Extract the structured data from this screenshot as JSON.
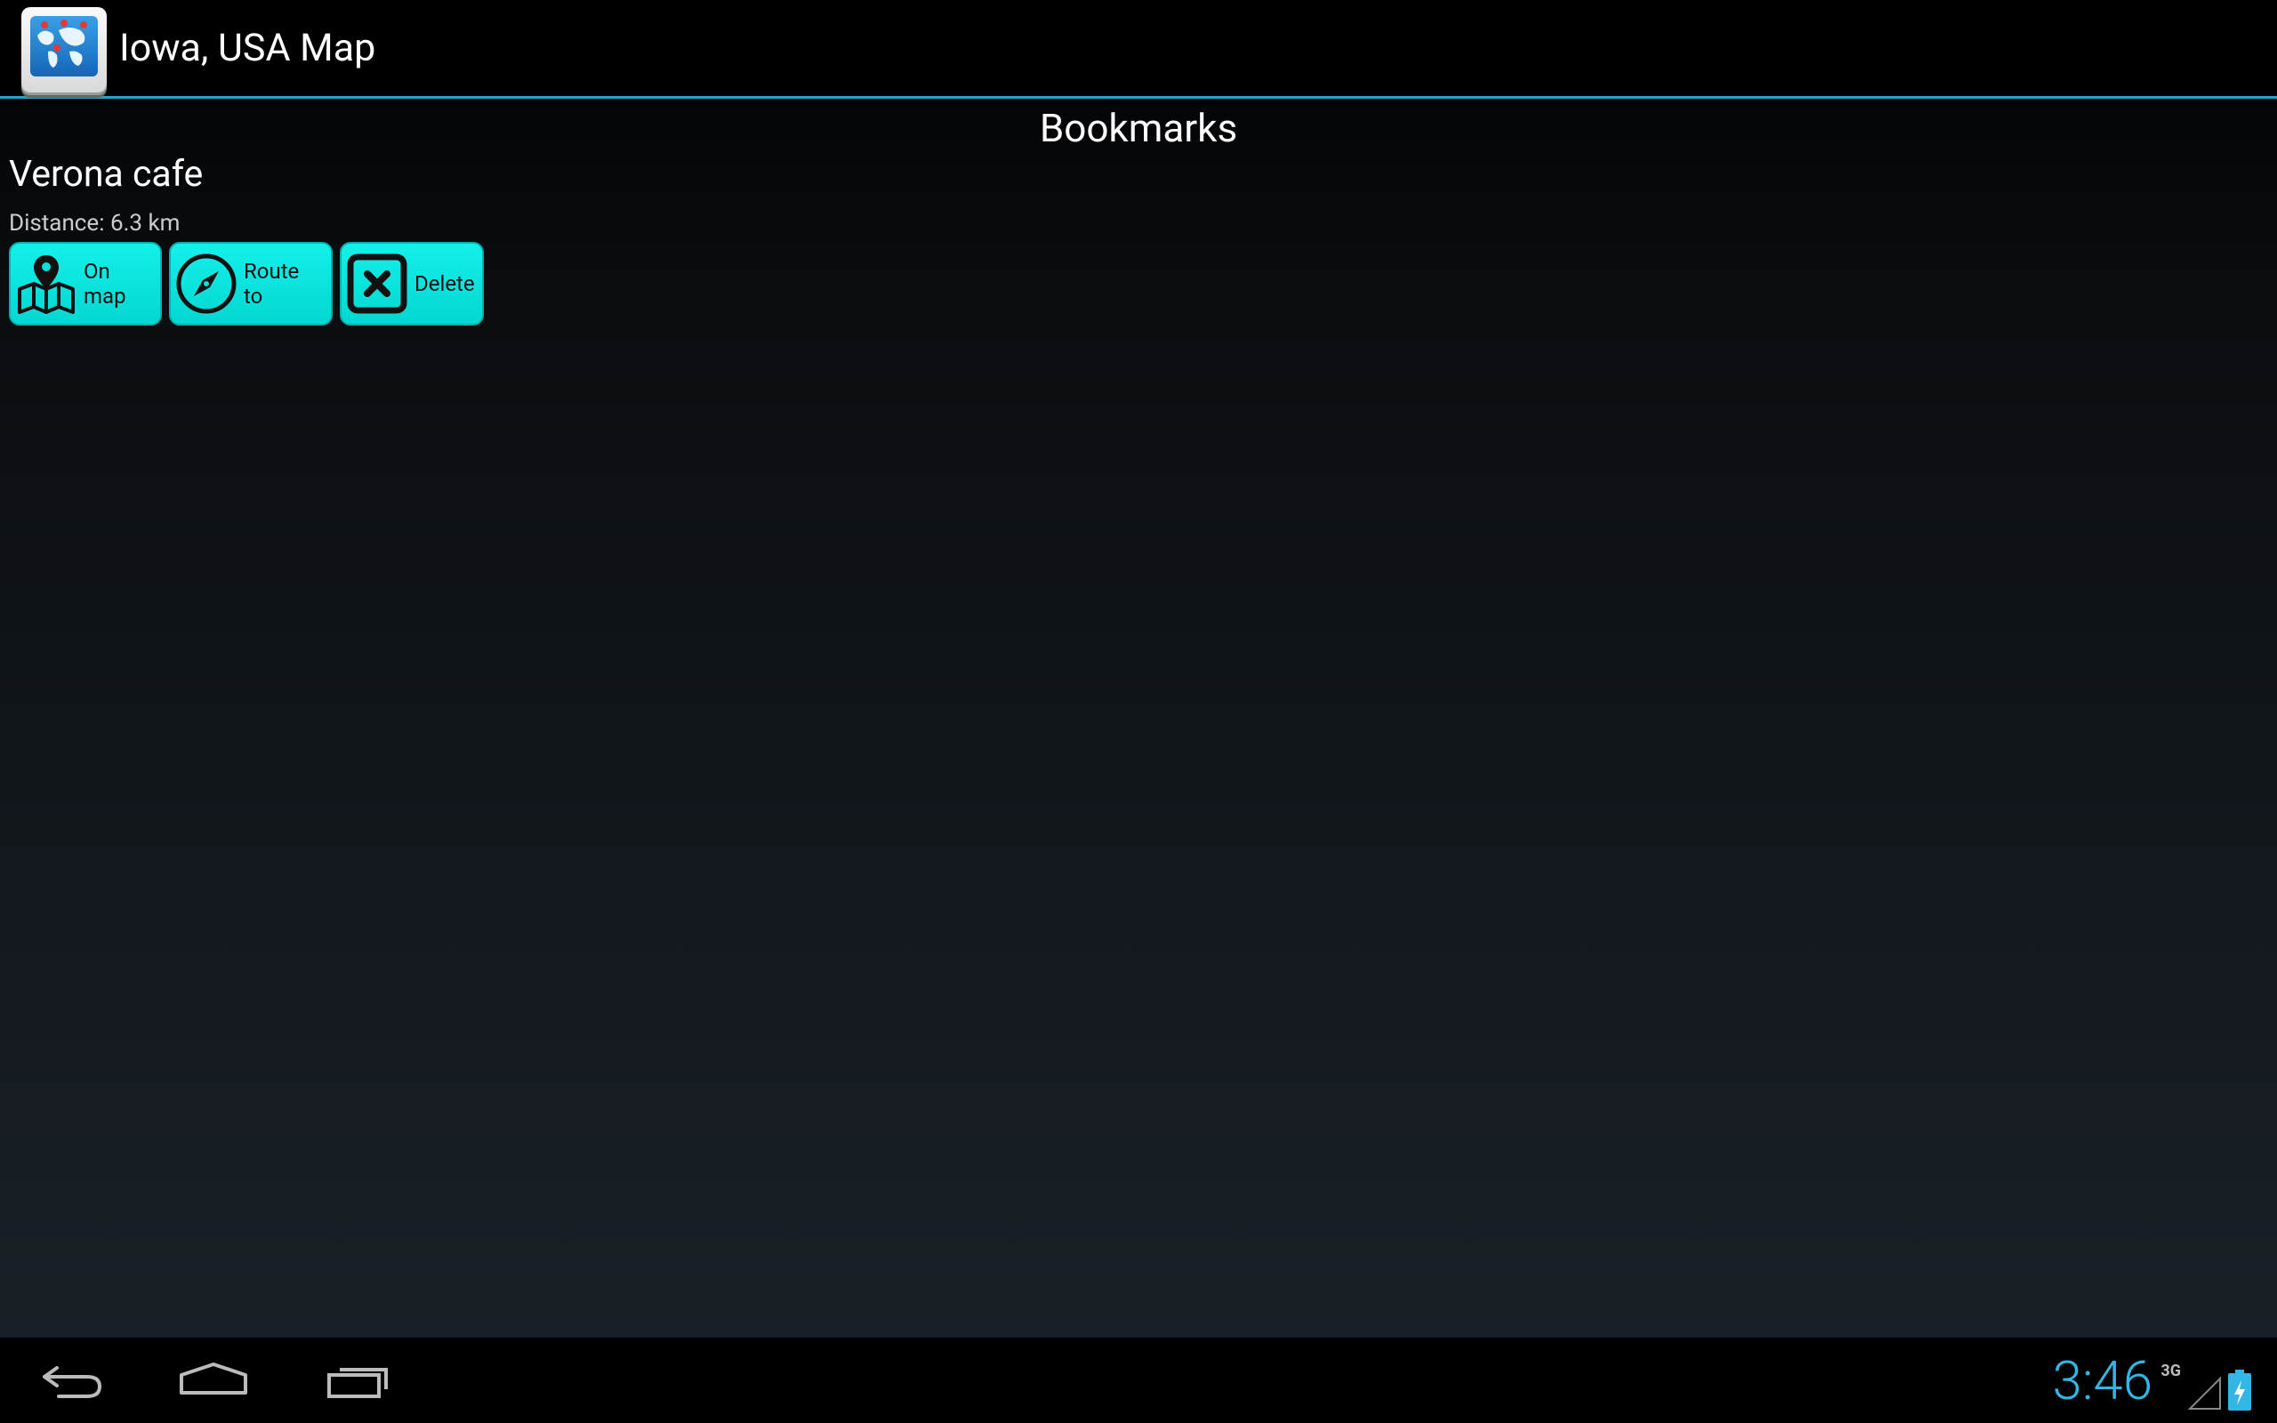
{
  "app": {
    "title": "Iowa, USA Map"
  },
  "content": {
    "section_title": "Bookmarks",
    "bookmark": {
      "name": "Verona  cafe",
      "distance": "Distance: 6.3 km"
    },
    "buttons": {
      "on_map": "On map",
      "route_to": "Route to",
      "delete": "Delete"
    }
  },
  "status_bar": {
    "clock": "3:46",
    "network": "3G"
  },
  "colors": {
    "accent": "#33b5e5",
    "button": "#08e0db",
    "divider": "#2a9fc9"
  },
  "icons": {
    "app": "world-map-icon",
    "on_map": "map-pin-icon",
    "route_to": "compass-icon",
    "delete": "close-box-icon",
    "back": "back-icon",
    "home": "home-icon",
    "recents": "recent-apps-icon",
    "signal": "signal-icon",
    "battery": "battery-charging-icon"
  }
}
